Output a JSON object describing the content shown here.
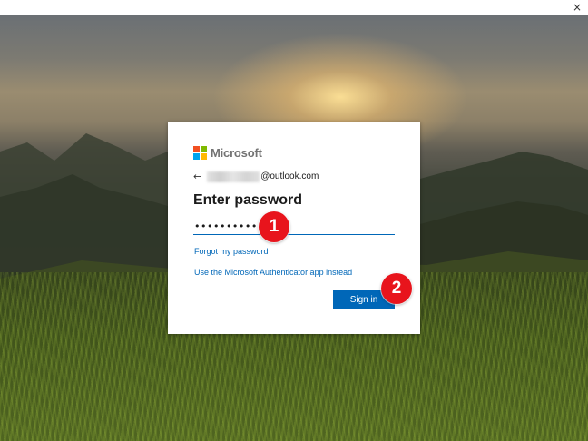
{
  "window": {
    "close_glyph": "×"
  },
  "dialog": {
    "brand": {
      "name": "Microsoft",
      "colors": [
        "#f25022",
        "#7fba00",
        "#00a4ef",
        "#ffb900"
      ]
    },
    "identity": {
      "back_glyph": "←",
      "email_domain": "@outlook.com"
    },
    "heading": "Enter password",
    "password": {
      "masked_value": "•••••••••••••••"
    },
    "links": {
      "forgot": "Forgot my password",
      "authenticator": "Use the Microsoft Authenticator app instead"
    },
    "signin_label": "Sign in"
  },
  "annotations": {
    "step1": "1",
    "step2": "2"
  },
  "colors": {
    "accent": "#0067b8",
    "badge": "#e8141c"
  }
}
